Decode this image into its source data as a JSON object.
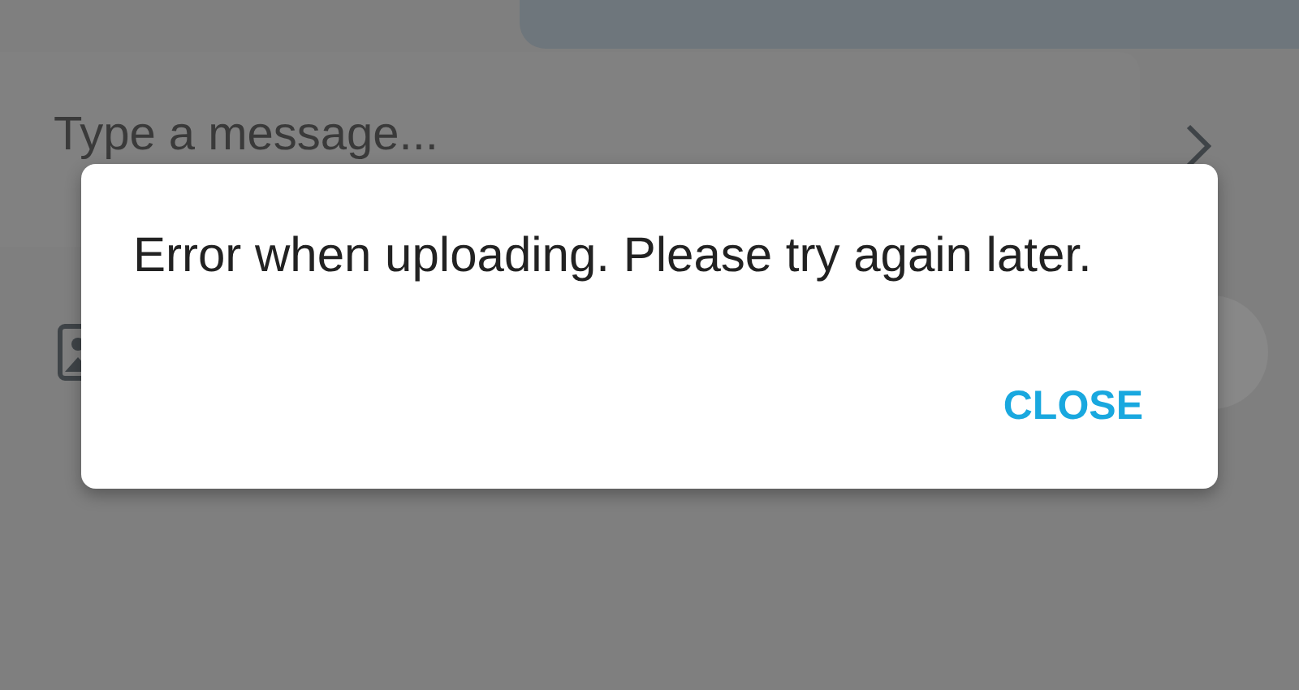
{
  "composer": {
    "placeholder": "Type a message..."
  },
  "dialog": {
    "message": "Error when uploading. Please try again later.",
    "buttons": [
      "CLOSE"
    ]
  }
}
